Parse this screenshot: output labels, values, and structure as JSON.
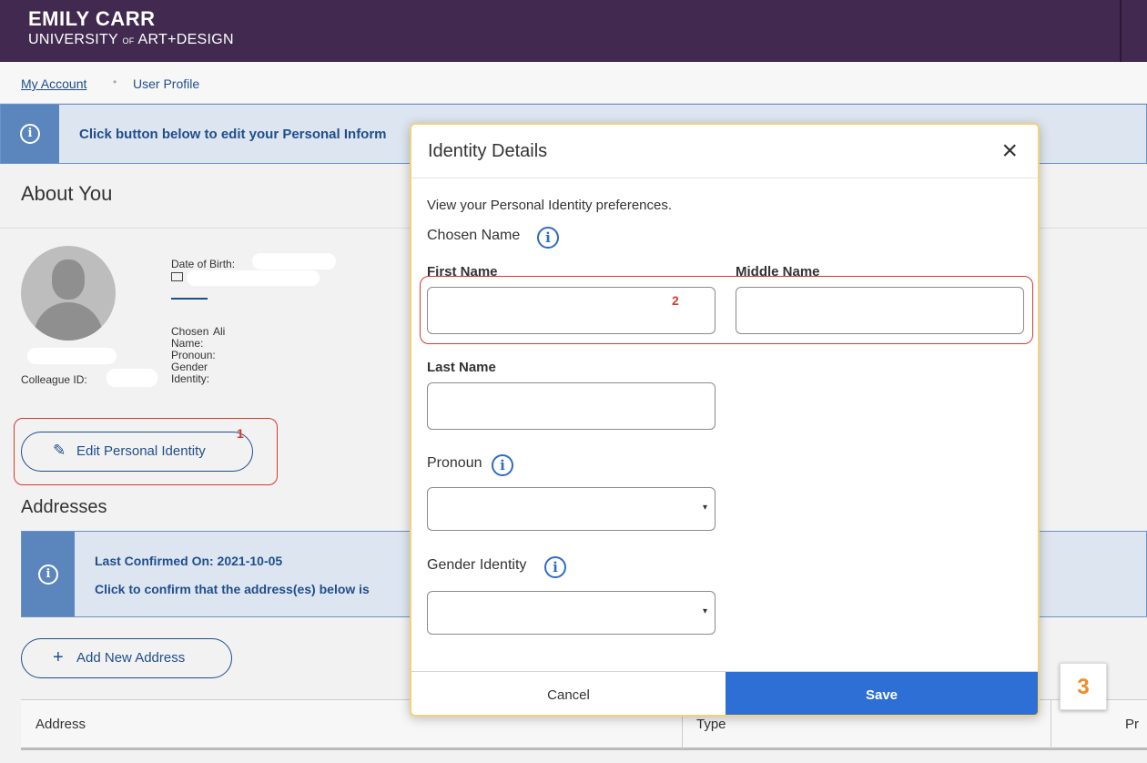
{
  "header": {
    "logo_line1": "EMILY CARR",
    "logo_line2_a": "UNIVERSITY",
    "logo_line2_of": "OF",
    "logo_line2_b": "ART+DESIGN"
  },
  "breadcrumb": {
    "link": "My Account",
    "separator": "•",
    "current": "User Profile"
  },
  "info_banner": {
    "text": "Click button below to edit your Personal Inform"
  },
  "about": {
    "heading": "About You",
    "dob_label": "Date of Birth:",
    "chosen_name_label": "Chosen",
    "chosen_name_label2": "Name:",
    "chosen_name_value": "Ali",
    "pronoun_label": "Pronoun:",
    "gender_label": "Gender",
    "gender_label2": "Identity:",
    "colleague_label": "Colleague ID:",
    "edit_button": "Edit Personal Identity"
  },
  "addresses": {
    "heading": "Addresses",
    "banner_title": "Last Confirmed On: 2021-10-05",
    "banner_text": "Click to confirm that the address(es) below is",
    "add_button": "Add New Address",
    "columns": [
      "Address",
      "Type",
      "Pr"
    ]
  },
  "modal": {
    "title": "Identity Details",
    "close": "×",
    "description": "View your Personal Identity preferences.",
    "chosen_name": "Chosen Name",
    "first_name": "First Name",
    "middle_name": "Middle Name",
    "last_name": "Last Name",
    "pronoun": "Pronoun",
    "gender_identity": "Gender Identity",
    "cancel": "Cancel",
    "save": "Save"
  },
  "annotations": {
    "one": "1",
    "two": "2",
    "three": "3"
  },
  "colors": {
    "header": "#42294f",
    "link": "#1f4e8c",
    "save": "#2d6fd4",
    "annotation": "#d9392b"
  },
  "icons": [
    "info-icon",
    "close-icon",
    "pencil-icon",
    "plus-icon",
    "mail-icon",
    "chevron-down-icon"
  ]
}
